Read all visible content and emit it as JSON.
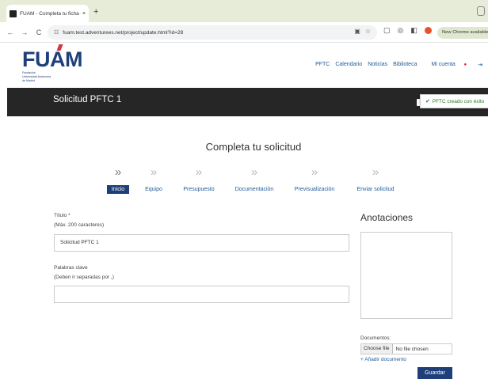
{
  "browser": {
    "tab_title": "FUAM - Completa tu ficha de",
    "tab_close": "×",
    "new_tab": "+",
    "back": "←",
    "forward": "→",
    "reload": "C",
    "url": "fuam.test.adventurees.net/project/update.html?id=28",
    "new_chrome": "New Chrome available"
  },
  "header": {
    "logo_text": "FUAM",
    "logo_sub": [
      "Fundación",
      "Universidad Autónoma",
      "de Madrid"
    ],
    "nav": [
      "PFTC",
      "Calendario",
      "Noticias",
      "Biblioteca"
    ],
    "account": "Mi cuenta"
  },
  "title_bar": {
    "title": "Solicitud PFTC 1"
  },
  "toast": {
    "check": "✔",
    "message": "PFTC creado con éxito"
  },
  "page": {
    "heading": "Completa tu solicitud",
    "steps": [
      {
        "label": "Inicio",
        "active": true
      },
      {
        "label": "Equipo"
      },
      {
        "label": "Presupuesto"
      },
      {
        "label": "Documentación"
      },
      {
        "label": "Previsualización"
      },
      {
        "label": "Enviar solicitud"
      }
    ],
    "title_field": {
      "label": "Título *",
      "hint": "(Máx. 200 caracteres)",
      "value": "Solicitud PFTC 1"
    },
    "keywords_field": {
      "label": "Palabras clave",
      "hint": "(Deben ir separadas por ,)",
      "value": ""
    }
  },
  "sidebar": {
    "notes_title": "Anotaciones",
    "docs_label": "Documentos:",
    "choose_file": "Choose file",
    "no_file": "No file chosen",
    "add_doc": "+ Añadir documento",
    "save": "Guardar"
  },
  "colors": {
    "brand_navy": "#1f3f7a",
    "title_bar": "#262626",
    "success": "#2a7a2a"
  }
}
